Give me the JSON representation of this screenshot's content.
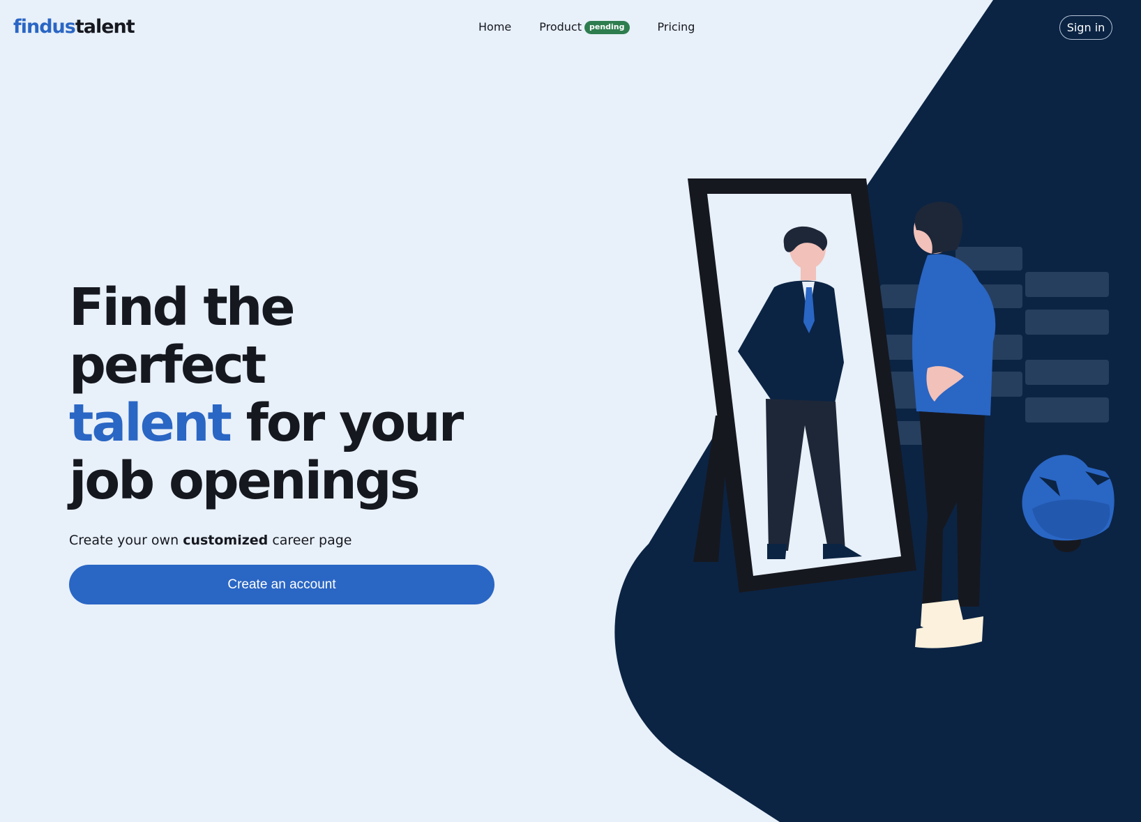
{
  "header": {
    "logo_part1": "findus",
    "logo_part2": "talent",
    "nav": {
      "home": "Home",
      "product": "Product",
      "product_badge": "pending",
      "pricing": "Pricing"
    },
    "signin_label": "Sign in"
  },
  "hero": {
    "headline_line1": "Find the perfect",
    "headline_accent": "talent",
    "headline_line2_rest": " for your",
    "headline_line3": "job openings",
    "subline_before": "Create your own ",
    "subline_bold": "customized",
    "subline_after": " career page",
    "cta_label": "Create an account"
  },
  "colors": {
    "background": "#e8f0f9",
    "navy": "#0b2444",
    "accent": "#2a66c4",
    "badge_green": "#2e7d4f",
    "text_dark": "#16181f"
  },
  "illustration": {
    "name": "person-looking-in-mirror-illustration"
  }
}
